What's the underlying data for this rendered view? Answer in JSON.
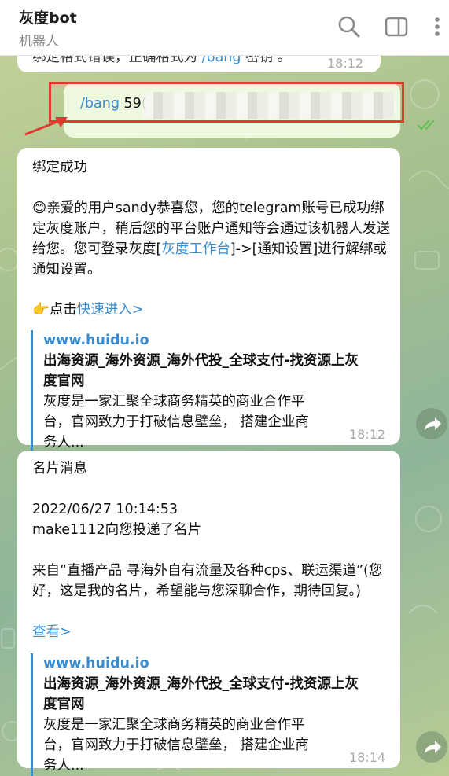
{
  "header": {
    "title": "灰度bot",
    "subtitle": "机器人",
    "icons": [
      "search-icon",
      "sidebar-toggle-icon",
      "more-vertical-icon"
    ]
  },
  "prev_message": {
    "text_a": "绑定格式错误，正确格式为 ",
    "cmd": "/bang",
    "text_b": " 密钥 。",
    "time": "18:12"
  },
  "outgoing_message": {
    "cmd": "/bang",
    "arg_prefix": "59(",
    "status": "read"
  },
  "bind_message": {
    "heading": "绑定成功",
    "emoji": "😊",
    "body_1": "亲爱的用户sandy恭喜您，您的telegram账号已成功绑定灰度账户，稍后您的平台账户通知等会通过该机器人发送给您。您可登录灰度[",
    "body_link": "灰度工作台",
    "body_2": "]->[通知设置]进行解绑或通知设置。",
    "point_emoji": "👉",
    "cta_prefix": "点击",
    "cta_link": "快速进入>",
    "preview": {
      "site": "www.huidu.io",
      "title": "出海资源_海外资源_海外代投_全球支付-找资源上灰度官网",
      "desc": "灰度是一家汇聚全球商务精英的商业合作平台，官网致力于打破信息壁垒， 搭建企业商务人..."
    },
    "time": "18:12"
  },
  "card_message": {
    "heading": "名片消息",
    "date": "2022/06/27 10:14:53",
    "line": "make1112向您投递了名片",
    "from": "来自“直播产品 寻海外自有流量及各种cps、联运渠道”(您好，这是我的名片，希望能与您深聊合作，期待回复。)",
    "view_link": "查看>",
    "preview": {
      "site": "www.huidu.io",
      "title": "出海资源_海外资源_海外代投_全球支付-找资源上灰度官网",
      "desc": "灰度是一家汇聚全球商务精英的商业合作平台，官网致力于打破信息壁垒， 搭建企业商务人..."
    },
    "time": "18:14"
  },
  "colors": {
    "link": "#3a8ccf",
    "annotation": "#e03a2f",
    "outgoing_bubble": "#eef8df",
    "read_check": "#5fbf52"
  }
}
